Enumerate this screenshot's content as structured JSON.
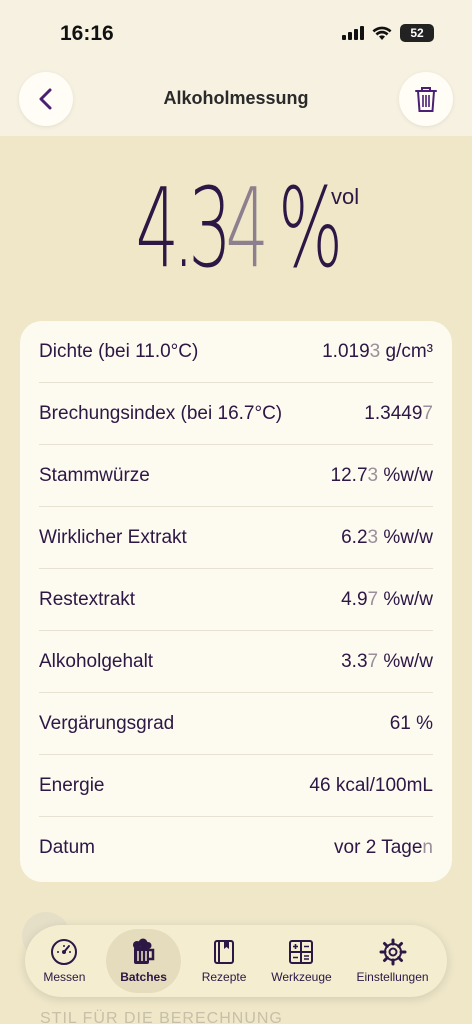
{
  "status": {
    "time": "16:16",
    "battery": "52"
  },
  "header": {
    "title": "Alkoholmessung"
  },
  "result": {
    "main": "4.3",
    "dim_digit": "4",
    "percent": " %",
    "unit": "vol"
  },
  "rows": [
    {
      "label": "Dichte (bei 11.0°C)",
      "value": "1.019",
      "dim": "3",
      "suffix": " g/cm³"
    },
    {
      "label": "Brechungsindex (bei 16.7°C)",
      "value": "1.3449",
      "dim": "7",
      "suffix": ""
    },
    {
      "label": "Stammwürze",
      "value": "12.7",
      "dim": "3",
      "suffix": " %w/w"
    },
    {
      "label": "Wirklicher Extrakt",
      "value": "6.2",
      "dim": "3",
      "suffix": " %w/w"
    },
    {
      "label": "Restextrakt",
      "value": "4.9",
      "dim": "7",
      "suffix": " %w/w"
    },
    {
      "label": "Alkoholgehalt",
      "value": "3.3",
      "dim": "7",
      "suffix": " %w/w"
    },
    {
      "label": "Vergärungsgrad",
      "value": "61 %",
      "dim": "",
      "suffix": ""
    },
    {
      "label": "Energie",
      "value": "46 kcal/100mL",
      "dim": "",
      "suffix": ""
    },
    {
      "label": "Datum",
      "value": "vor 2 Tage",
      "dim": "n",
      "suffix": ""
    }
  ],
  "faded_text": "STIL FÜR DIE BERECHNUNG",
  "tabs": [
    {
      "label": "Messen",
      "icon": "gauge-icon"
    },
    {
      "label": "Batches",
      "icon": "beer-mug-icon",
      "active": true
    },
    {
      "label": "Rezepte",
      "icon": "book-icon"
    },
    {
      "label": "Werkzeuge",
      "icon": "calculator-icon"
    },
    {
      "label": "Einstellungen",
      "icon": "gear-icon"
    }
  ],
  "colors": {
    "accent": "#4b1f74",
    "text": "#2c1745",
    "background": "#efe7c8",
    "card": "#fdfaf0"
  }
}
